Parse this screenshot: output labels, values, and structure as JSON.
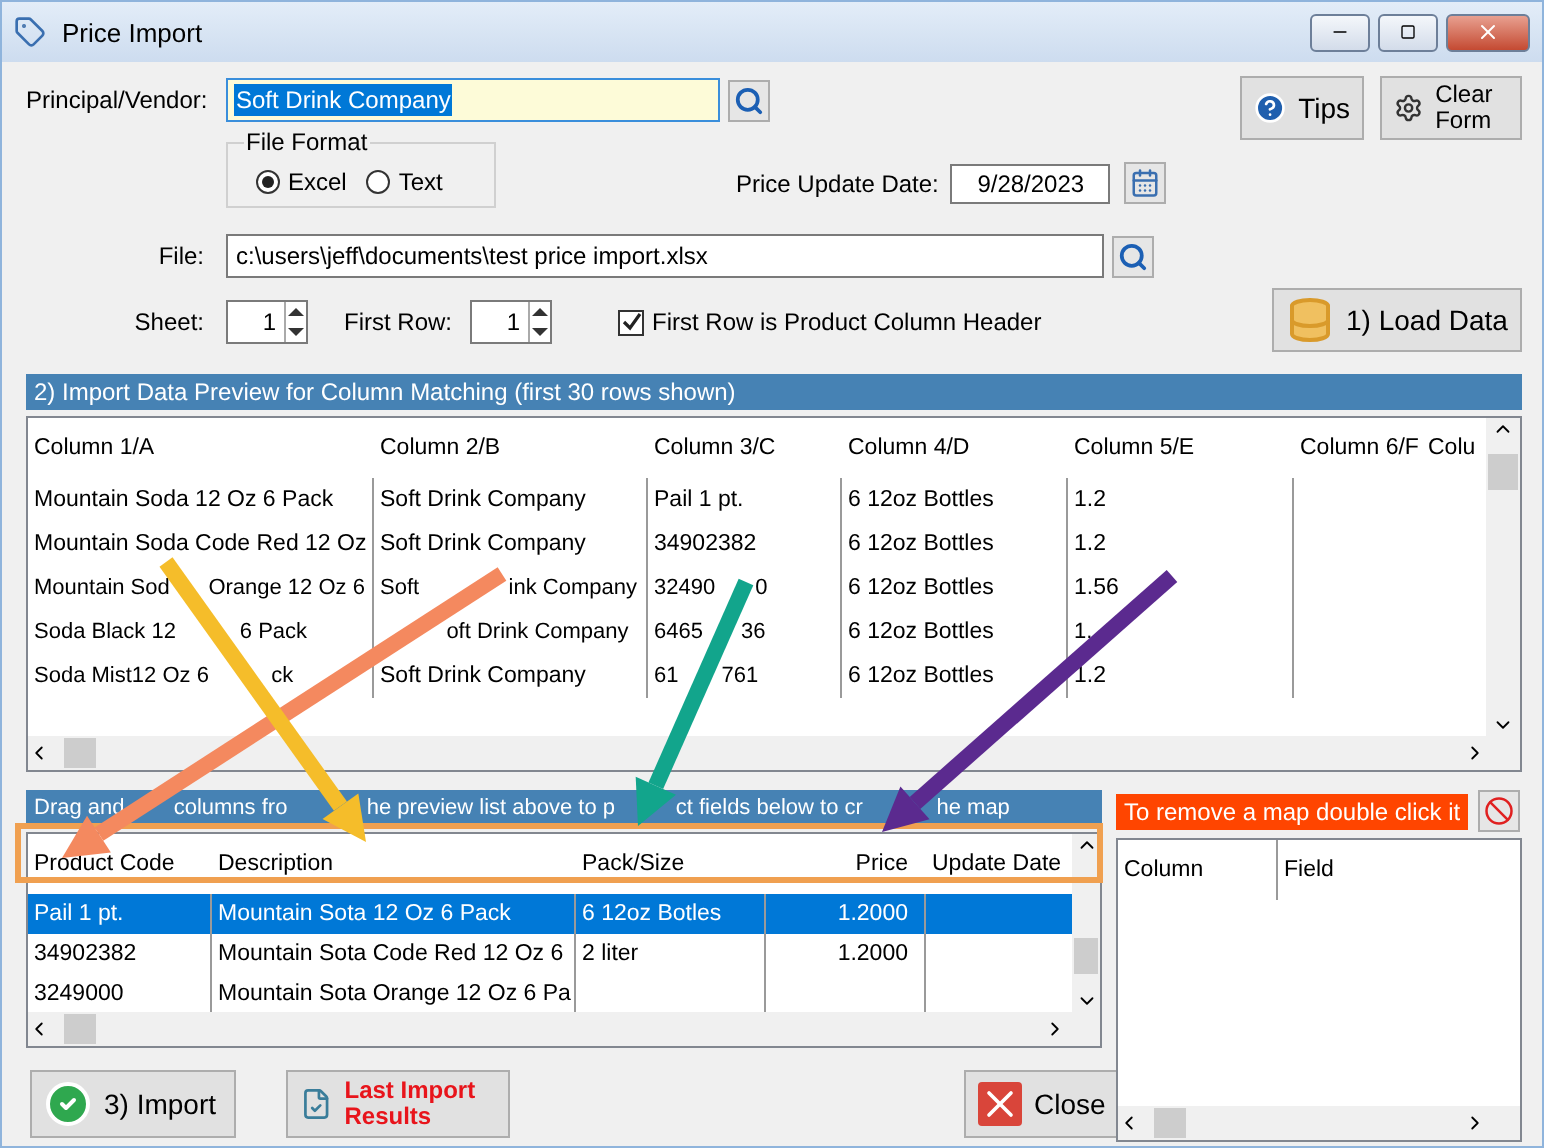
{
  "window": {
    "title": "Price Import"
  },
  "vendor": {
    "label": "Principal/Vendor:",
    "value": "Soft Drink Company"
  },
  "tips_button": "Tips",
  "clear_button": "Clear Form",
  "file_format": {
    "legend": "File Format",
    "options": [
      {
        "label": "Excel",
        "selected": true
      },
      {
        "label": "Text",
        "selected": false
      }
    ]
  },
  "price_update_date": {
    "label": "Price Update Date:",
    "value": "9/28/2023"
  },
  "file": {
    "label": "File:",
    "value": "c:\\users\\jeff\\documents\\test price import.xlsx"
  },
  "sheet": {
    "label": "Sheet:",
    "value": "1"
  },
  "first_row": {
    "label": "First Row:",
    "value": "1"
  },
  "header_checkbox": {
    "label": "First Row is Product Column Header",
    "checked": true
  },
  "load_button": "1)  Load Data",
  "preview": {
    "title": "2) Import Data Preview for Column Matching (first 30 rows shown)",
    "columns": [
      "Column 1/A",
      "Column 2/B",
      "Column 3/C",
      "Column 4/D",
      "Column 5/E",
      "Column 6/F",
      "Colu"
    ],
    "rows": [
      [
        "Mountain Soda 12 Oz 6 Pack",
        "Soft Drink Company",
        "Pail 1 pt.",
        "6 12oz Bottles",
        "1.2"
      ],
      [
        "Mountain Soda Code Red 12 Oz",
        "Soft Drink Company",
        "34902382",
        "6 12oz Bottles",
        "1.2"
      ],
      [
        [
          "Mountain Sod",
          "Orange 12 Oz 6"
        ],
        [
          "Soft",
          "ink Company"
        ],
        [
          "32490",
          "0"
        ],
        "6 12oz Bottles",
        "1.56"
      ],
      [
        [
          "Soda Black 12",
          "6 Pack"
        ],
        [
          null,
          "oft Drink Company"
        ],
        [
          "6465",
          "36"
        ],
        "6 12oz Bottles",
        [
          "1."
        ]
      ],
      [
        [
          "Soda Mist12 Oz 6",
          "ck"
        ],
        "Soft Drink Company",
        [
          "61",
          "761"
        ],
        "6 12oz Bottles",
        "1.2"
      ]
    ]
  },
  "mapping": {
    "instruction": [
      "Drag and",
      "columns fro",
      "he preview list above to p",
      "ct fields below to cr",
      "he map"
    ],
    "columns": [
      "Product Code",
      "Description",
      "Pack/Size",
      "Price",
      "Update Date"
    ],
    "rows": [
      {
        "selected": true,
        "cells": [
          "Pail 1 pt.",
          "Mountain Sota 12 Oz 6 Pack",
          "6 12oz Botles",
          "1.2000"
        ]
      },
      {
        "selected": false,
        "cells": [
          "34902382",
          "Mountain Sota Code Red 12 Oz 6",
          "2 liter",
          "1.2000"
        ]
      },
      {
        "selected": false,
        "cells": [
          "3249000",
          "Mountain Sota Orange 12 Oz 6 Pa"
        ]
      }
    ]
  },
  "remove_hint": "To remove a map double click it",
  "map_list": {
    "columns": [
      "Column",
      "Field"
    ]
  },
  "import_button": "3)  Import",
  "last_import_button": "Last Import Results",
  "close_button": "Close"
}
